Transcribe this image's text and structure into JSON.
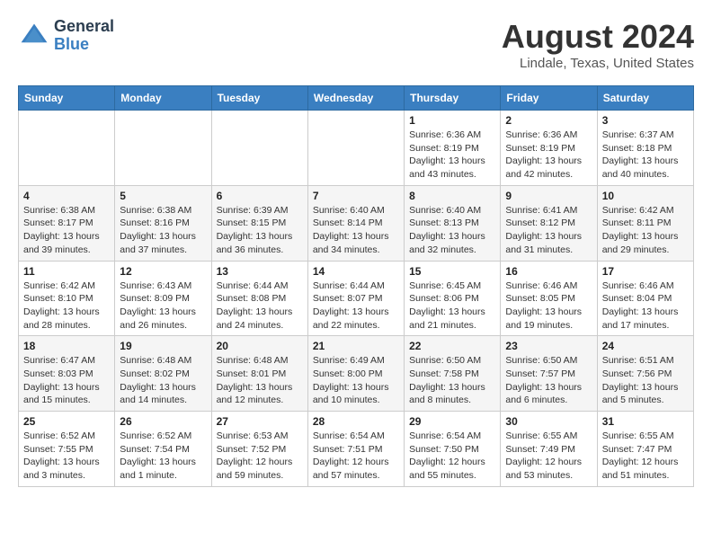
{
  "logo": {
    "line1": "General",
    "line2": "Blue"
  },
  "header": {
    "month": "August 2024",
    "location": "Lindale, Texas, United States"
  },
  "weekdays": [
    "Sunday",
    "Monday",
    "Tuesday",
    "Wednesday",
    "Thursday",
    "Friday",
    "Saturday"
  ],
  "weeks": [
    [
      {
        "day": "",
        "info": ""
      },
      {
        "day": "",
        "info": ""
      },
      {
        "day": "",
        "info": ""
      },
      {
        "day": "",
        "info": ""
      },
      {
        "day": "1",
        "info": "Sunrise: 6:36 AM\nSunset: 8:19 PM\nDaylight: 13 hours\nand 43 minutes."
      },
      {
        "day": "2",
        "info": "Sunrise: 6:36 AM\nSunset: 8:19 PM\nDaylight: 13 hours\nand 42 minutes."
      },
      {
        "day": "3",
        "info": "Sunrise: 6:37 AM\nSunset: 8:18 PM\nDaylight: 13 hours\nand 40 minutes."
      }
    ],
    [
      {
        "day": "4",
        "info": "Sunrise: 6:38 AM\nSunset: 8:17 PM\nDaylight: 13 hours\nand 39 minutes."
      },
      {
        "day": "5",
        "info": "Sunrise: 6:38 AM\nSunset: 8:16 PM\nDaylight: 13 hours\nand 37 minutes."
      },
      {
        "day": "6",
        "info": "Sunrise: 6:39 AM\nSunset: 8:15 PM\nDaylight: 13 hours\nand 36 minutes."
      },
      {
        "day": "7",
        "info": "Sunrise: 6:40 AM\nSunset: 8:14 PM\nDaylight: 13 hours\nand 34 minutes."
      },
      {
        "day": "8",
        "info": "Sunrise: 6:40 AM\nSunset: 8:13 PM\nDaylight: 13 hours\nand 32 minutes."
      },
      {
        "day": "9",
        "info": "Sunrise: 6:41 AM\nSunset: 8:12 PM\nDaylight: 13 hours\nand 31 minutes."
      },
      {
        "day": "10",
        "info": "Sunrise: 6:42 AM\nSunset: 8:11 PM\nDaylight: 13 hours\nand 29 minutes."
      }
    ],
    [
      {
        "day": "11",
        "info": "Sunrise: 6:42 AM\nSunset: 8:10 PM\nDaylight: 13 hours\nand 28 minutes."
      },
      {
        "day": "12",
        "info": "Sunrise: 6:43 AM\nSunset: 8:09 PM\nDaylight: 13 hours\nand 26 minutes."
      },
      {
        "day": "13",
        "info": "Sunrise: 6:44 AM\nSunset: 8:08 PM\nDaylight: 13 hours\nand 24 minutes."
      },
      {
        "day": "14",
        "info": "Sunrise: 6:44 AM\nSunset: 8:07 PM\nDaylight: 13 hours\nand 22 minutes."
      },
      {
        "day": "15",
        "info": "Sunrise: 6:45 AM\nSunset: 8:06 PM\nDaylight: 13 hours\nand 21 minutes."
      },
      {
        "day": "16",
        "info": "Sunrise: 6:46 AM\nSunset: 8:05 PM\nDaylight: 13 hours\nand 19 minutes."
      },
      {
        "day": "17",
        "info": "Sunrise: 6:46 AM\nSunset: 8:04 PM\nDaylight: 13 hours\nand 17 minutes."
      }
    ],
    [
      {
        "day": "18",
        "info": "Sunrise: 6:47 AM\nSunset: 8:03 PM\nDaylight: 13 hours\nand 15 minutes."
      },
      {
        "day": "19",
        "info": "Sunrise: 6:48 AM\nSunset: 8:02 PM\nDaylight: 13 hours\nand 14 minutes."
      },
      {
        "day": "20",
        "info": "Sunrise: 6:48 AM\nSunset: 8:01 PM\nDaylight: 13 hours\nand 12 minutes."
      },
      {
        "day": "21",
        "info": "Sunrise: 6:49 AM\nSunset: 8:00 PM\nDaylight: 13 hours\nand 10 minutes."
      },
      {
        "day": "22",
        "info": "Sunrise: 6:50 AM\nSunset: 7:58 PM\nDaylight: 13 hours\nand 8 minutes."
      },
      {
        "day": "23",
        "info": "Sunrise: 6:50 AM\nSunset: 7:57 PM\nDaylight: 13 hours\nand 6 minutes."
      },
      {
        "day": "24",
        "info": "Sunrise: 6:51 AM\nSunset: 7:56 PM\nDaylight: 13 hours\nand 5 minutes."
      }
    ],
    [
      {
        "day": "25",
        "info": "Sunrise: 6:52 AM\nSunset: 7:55 PM\nDaylight: 13 hours\nand 3 minutes."
      },
      {
        "day": "26",
        "info": "Sunrise: 6:52 AM\nSunset: 7:54 PM\nDaylight: 13 hours\nand 1 minute."
      },
      {
        "day": "27",
        "info": "Sunrise: 6:53 AM\nSunset: 7:52 PM\nDaylight: 12 hours\nand 59 minutes."
      },
      {
        "day": "28",
        "info": "Sunrise: 6:54 AM\nSunset: 7:51 PM\nDaylight: 12 hours\nand 57 minutes."
      },
      {
        "day": "29",
        "info": "Sunrise: 6:54 AM\nSunset: 7:50 PM\nDaylight: 12 hours\nand 55 minutes."
      },
      {
        "day": "30",
        "info": "Sunrise: 6:55 AM\nSunset: 7:49 PM\nDaylight: 12 hours\nand 53 minutes."
      },
      {
        "day": "31",
        "info": "Sunrise: 6:55 AM\nSunset: 7:47 PM\nDaylight: 12 hours\nand 51 minutes."
      }
    ]
  ]
}
